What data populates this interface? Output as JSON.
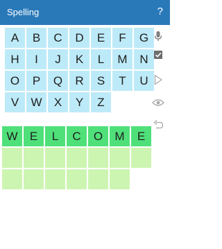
{
  "appbar": {
    "title": "Spelling",
    "help_label": "?"
  },
  "keyboard": {
    "keys": [
      "A",
      "B",
      "C",
      "D",
      "E",
      "F",
      "G",
      "H",
      "I",
      "J",
      "K",
      "L",
      "M",
      "N",
      "O",
      "P",
      "Q",
      "R",
      "S",
      "T",
      "U",
      "V",
      "W",
      "X",
      "Y",
      "Z"
    ]
  },
  "side_icons": [
    "microphone-icon",
    "check-icon",
    "play-icon",
    "eye-icon",
    "undo-icon"
  ],
  "answer": {
    "rows": [
      [
        "W",
        "E",
        "L",
        "C",
        "O",
        "M",
        "E"
      ],
      [
        "",
        "",
        "",
        "",
        "",
        "",
        ""
      ],
      [
        "",
        "",
        "",
        "",
        "",
        ""
      ]
    ]
  },
  "colors": {
    "appbar": "#2979b9",
    "key_bg": "#bdeaf8",
    "slot_empty": "#cdf5b2",
    "slot_filled": "#4fe07a",
    "icon_gray": "#9e9e9e"
  }
}
